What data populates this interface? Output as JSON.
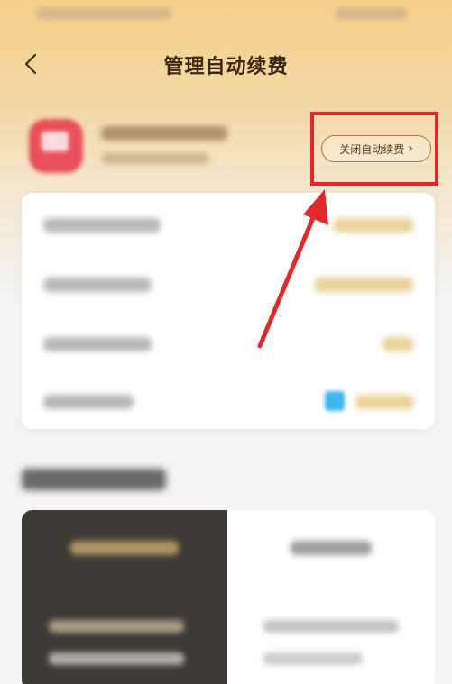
{
  "header": {
    "title": "管理自动续费"
  },
  "subscription": {
    "close_autorenew_label": "关闭自动续费"
  },
  "colors": {
    "accent_gold": "#f6cf8a",
    "annotation_red": "#e02929",
    "button_border": "#b07a3a",
    "dark_panel": "#3d3a36"
  },
  "icons": {
    "back": "chevron-left-icon",
    "button_chevron": "chevron-right-icon",
    "pay_method": "payment-app-icon"
  }
}
